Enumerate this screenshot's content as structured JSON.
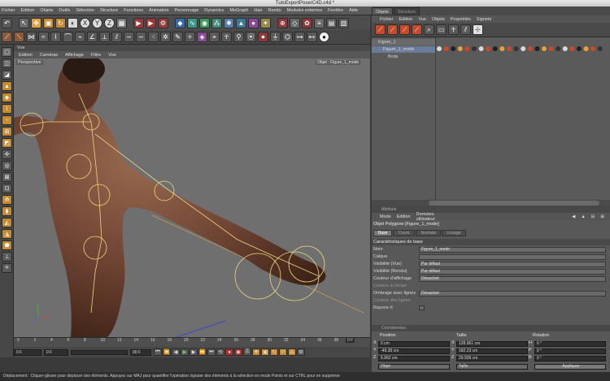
{
  "window": {
    "title": "TutoExportPoserC4D.c4d *"
  },
  "menubar": [
    "Fichier",
    "Edition",
    "Objets",
    "Outils",
    "Sélection",
    "Structure",
    "Fonctions",
    "Animation",
    "Personnage",
    "Dynamics",
    "MoGraph",
    "Hair",
    "Rendu",
    "Modules externes",
    "Fenêtre",
    "Aide"
  ],
  "viewport": {
    "title": "Vue",
    "menu": [
      "Edition",
      "Caméras",
      "Affichage",
      "Filtre",
      "Vue"
    ],
    "camera_label": "Perspective",
    "object_label": "Objet : Figure_1_mode"
  },
  "timeline": {
    "ticks": [
      "0",
      "2",
      "4",
      "6",
      "8",
      "10",
      "12",
      "14",
      "16",
      "18",
      "20",
      "22",
      "24",
      "26",
      "28",
      "30",
      "32",
      "34",
      "36",
      "38"
    ],
    "end_frame": "0 F",
    "current_frame": "0 F",
    "start_field": "0 F",
    "end_field": "90 F"
  },
  "object_manager": {
    "tabs": [
      {
        "label": "Objets",
        "active": true
      },
      {
        "label": "Structure",
        "active": false
      }
    ],
    "menu": [
      "Fichier",
      "Edition",
      "Vue",
      "Objets",
      "Propriétés",
      "Signets"
    ],
    "objects": [
      {
        "name": "Figure_1",
        "indent": 0
      },
      {
        "name": "Figure_1_mode",
        "indent": 1
      },
      {
        "name": "Body",
        "indent": 1
      }
    ]
  },
  "attributes": {
    "header": "Attributs",
    "menu": [
      "Mode",
      "Edition",
      "Données utilisateur"
    ],
    "object_title": "Objet Polygone [Figure_1_mode]",
    "tabs": [
      {
        "label": "Base",
        "active": true
      },
      {
        "label": "Coord.",
        "active": false
      },
      {
        "label": "Normale",
        "active": false
      },
      {
        "label": "Lissage",
        "active": false
      }
    ],
    "section": "Caractéristiques de base",
    "rows": [
      {
        "label": "Nom",
        "value": "Figure_1_mode"
      },
      {
        "label": "Calque",
        "value": ""
      },
      {
        "label": "Visibilité (Vue)",
        "value": "Par défaut"
      },
      {
        "label": "Visibilité (Rendu)",
        "value": "Par défaut"
      },
      {
        "label": "Couleur d'affichage",
        "value": "Désactivé"
      },
      {
        "label": "Couleur à l'écran",
        "value": ""
      },
      {
        "label": "Ombrage avec lignes",
        "value": "Désactivé"
      },
      {
        "label": "Couleur des lignes",
        "value": ""
      },
      {
        "label": "Rayons-X",
        "value": ""
      }
    ]
  },
  "coordinates": {
    "header": "Coordonnées",
    "columns": [
      "Position",
      "Taille",
      "Rotation"
    ],
    "rows": [
      {
        "axis": "X",
        "position": "0 cm",
        "size_axis": "X",
        "size": "128.961 cm",
        "rot_axis": "H",
        "rotation": "0 °"
      },
      {
        "axis": "Y",
        "position": "-49.38 cm",
        "size_axis": "Y",
        "size": "182.23 cm",
        "rot_axis": "P",
        "rotation": "0 °"
      },
      {
        "axis": "Z",
        "position": "5.962 cm",
        "size_axis": "Z",
        "size": "29.509 cm",
        "rot_axis": "B",
        "rotation": "0 °"
      }
    ],
    "mode_select": "Objet",
    "size_select": "Taille",
    "apply_button": "Appliquer"
  },
  "status": "Déplacement : Cliquer-glisser pour déplacer des éléments. Appuyez sur MAJ pour quantifier l'opération /ajouter des éléments à la sélection en mode Points et sur CTRL pour en supprimer",
  "colors": {
    "accent_orange": "#e8a23a",
    "skeleton": "#f0d480",
    "viewport_bg": "#6f6f6f"
  }
}
